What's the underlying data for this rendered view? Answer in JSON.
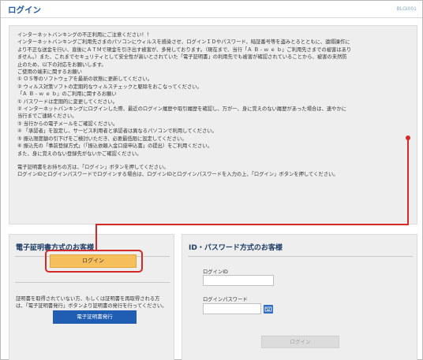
{
  "header": {
    "title": "ログイン",
    "screen_code": "BLGI001"
  },
  "notice": {
    "lines": [
      "インターネットバンキングの不正利用にご注意ください！！",
      "インターネットバンキングご利用先さまのパソコンにウィルスを感染させ、ログインＩＤやパスワード、暗証番号等を盗みとるとともに、遠隔操作に",
      "より不正な送金を行い、直後にＡＴＭで現金を引き出す被害が、多発しております。（現在まで、当行「Ａ Ｂ - ｗ ｅ ｂ」ご利用先さまでの被害はあり",
      "ません。）また、これまでセキュリティとして安全性が高いとされていた「電子証明書」の利用先でも被害が確認されていることから、被害の未然防",
      "止のため、以下の対応をお願いします。",
      "ご使用の端末に関するお願い",
      "① ＯＳ等のソフトウェアを最新の状態に更新してください。",
      "② ウィルス対策ソフトの定期的なウィルスチェックと駆除をおこなってください。",
      "「Ａ Ｂ - ｗ ｅ ｂ」のご利用に関するお願い",
      "① パスワードは定期的に変更してください。",
      "② インターネットバンキングにログインした際、最近のログイン履歴や取引履歴を確認し、万が一、身に覚えのない履歴があった場合は、速やかに",
      "当行までご連絡ください。",
      "③ 当行からの電子メールをご確認ください。",
      "④ 「承認者」を設定し、サービス利用者と承認者は異なるパソコンで利用してください。",
      "⑤ 振込限度額の引下げをご検討いただき、必要最低限に設定してください。",
      "⑥ 振込先の「事前登録方式」（「振込依頼入金口座申込書」の提出）をご利用ください。",
      "また、身に覚えのない登録先がないかご確認ください。"
    ],
    "footer_lines": [
      "電子証明書をお持ちの方は、「ログイン」ボタンを押してください。",
      "ログインIDとログインパスワードでログインする場合は、ログインIDとログインパスワードを入力の上、「ログイン」ボタンを押してください。"
    ]
  },
  "cert_panel": {
    "title": "電子証明書方式のお客様",
    "login_label": "ログイン",
    "note": "証明書を取得されていない方、もしくは証明書を再取得される方は、「電子証明書発行」ボタンより証明書の発行を行ってください。",
    "issue_label": "電子証明書発行"
  },
  "id_panel": {
    "title": "ID・パスワード方式のお客様",
    "id_label": "ログインID",
    "id_value": "",
    "password_label": "ログインパスワード",
    "password_value": "",
    "keyboard_icon": "software-keyboard-icon",
    "login_label": "ログイン"
  },
  "colors": {
    "title_blue": "#1e5ba8",
    "login_orange": "#f7bf5c",
    "issue_blue": "#1f5eb3",
    "highlight_red": "#d42929",
    "panel_gray": "#eeeeee"
  }
}
